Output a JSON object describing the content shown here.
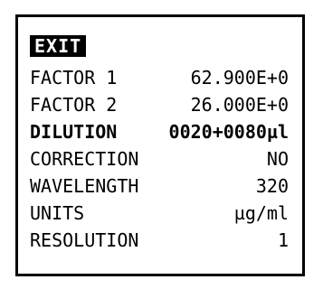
{
  "screen": {
    "exit_label": "EXIT",
    "rows": [
      {
        "label": "FACTOR 1",
        "value": "62.900E+0"
      },
      {
        "label": "FACTOR 2",
        "value": "26.000E+0"
      },
      {
        "label": "DILUTION",
        "value": "0020+0080µl"
      },
      {
        "label": "CORRECTION",
        "value": "NO"
      },
      {
        "label": "WAVELENGTH",
        "value": "320"
      },
      {
        "label": "UNITS",
        "value": "µg/ml"
      },
      {
        "label": "RESOLUTION",
        "value": "1"
      }
    ]
  }
}
